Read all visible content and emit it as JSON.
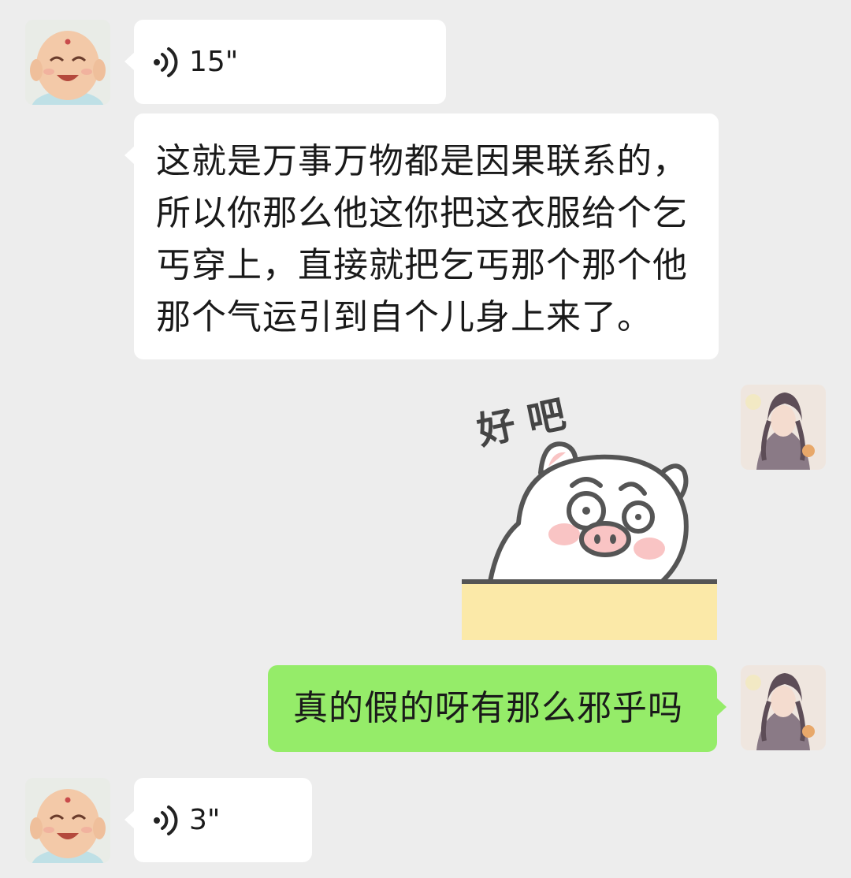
{
  "messages": [
    {
      "type": "voice",
      "side": "left",
      "duration": "15\"",
      "avatar": "smiling-buddha-avatar"
    },
    {
      "type": "text",
      "side": "left",
      "lines": [
        "这就是万事万物都是因果联系的，",
        "所以你那么他这你把这衣服给个乞",
        "丐穿上，直接就把乞丐那个那个他",
        "那个气运引到自个儿身上来了。"
      ]
    },
    {
      "type": "sticker",
      "side": "right",
      "caption": "好 吧",
      "avatar": "anime-girl-avatar"
    },
    {
      "type": "text",
      "side": "right",
      "text": "真的假的呀有那么邪乎吗",
      "avatar": "anime-girl-avatar"
    },
    {
      "type": "voice",
      "side": "left",
      "duration": "3\"",
      "avatar": "smiling-buddha-avatar"
    }
  ],
  "colors": {
    "background": "#ededed",
    "bubble_received": "#ffffff",
    "bubble_sent": "#95ec69",
    "sticker_table": "#fbe9a8"
  }
}
